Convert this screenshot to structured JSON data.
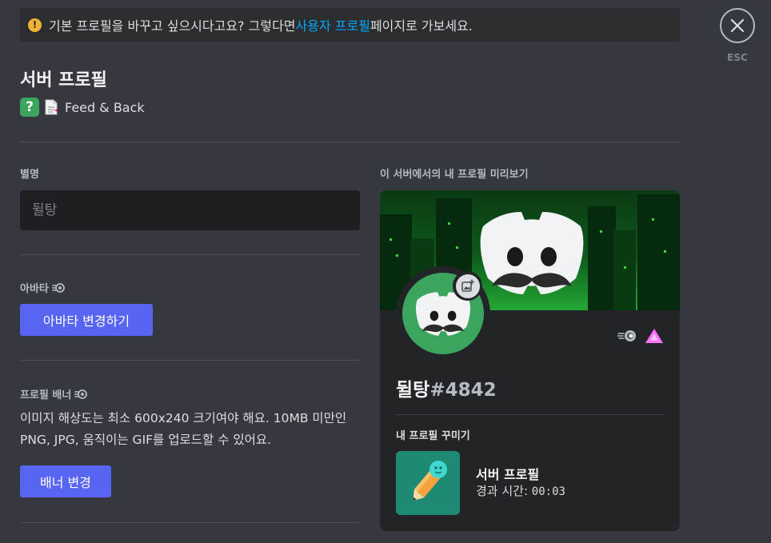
{
  "notice": {
    "text_before": "기본 프로필을 바꾸고 싶으시다고요? 그렇다면 ",
    "link": "사용자 프로필",
    "text_after": " 페이지로 가보세요."
  },
  "close": {
    "esc_label": "ESC"
  },
  "page": {
    "title": "서버 프로필",
    "server_name": "Feed & Back"
  },
  "nickname": {
    "label": "별명",
    "placeholder": "뒬탕"
  },
  "avatar_section": {
    "label": "아바타",
    "button": "아바타 변경하기"
  },
  "banner_section": {
    "label": "프로필 배너",
    "description": "이미지 해상도는 최소 600x240 크기여야 해요. 10MB 미만인 PNG, JPG, 움직이는 GIF를 업로드할 수 있어요.",
    "button": "배너 변경"
  },
  "preview": {
    "label": "이 서버에서의 내 프로필 미리보기",
    "username": "뒬탕",
    "discriminator": "#4842",
    "customize_label": "내 프로필 꾸미기",
    "activity_title": "서버 프로필",
    "activity_prefix": "경과 시간: ",
    "activity_time": "00:03"
  },
  "colors": {
    "background": "#36383f",
    "accent": "#5865f2",
    "link": "#00a8fc",
    "warning": "#f0b232",
    "avatar_bg": "#3ba55d"
  }
}
